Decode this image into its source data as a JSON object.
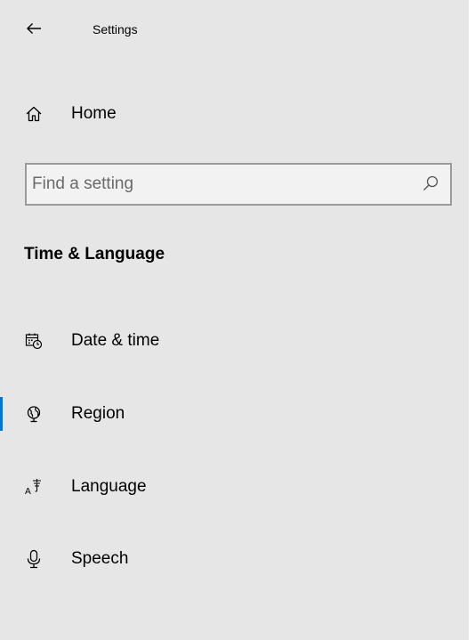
{
  "header": {
    "title": "Settings",
    "back_icon": "arrow-left-icon"
  },
  "nav": {
    "home": {
      "label": "Home",
      "icon": "home-icon"
    }
  },
  "search": {
    "placeholder": "Find a setting",
    "value": "",
    "icon": "search-icon"
  },
  "section": {
    "title": "Time & Language"
  },
  "menu": {
    "items": [
      {
        "label": "Date & time",
        "icon": "calendar-clock-icon",
        "selected": false
      },
      {
        "label": "Region",
        "icon": "globe-icon",
        "selected": true
      },
      {
        "label": "Language",
        "icon": "language-icon",
        "selected": false
      },
      {
        "label": "Speech",
        "icon": "microphone-icon",
        "selected": false
      }
    ]
  },
  "colors": {
    "pane_background": "#e6e6e6",
    "accent": "#0078d7",
    "search_border": "#9a9a9a"
  }
}
